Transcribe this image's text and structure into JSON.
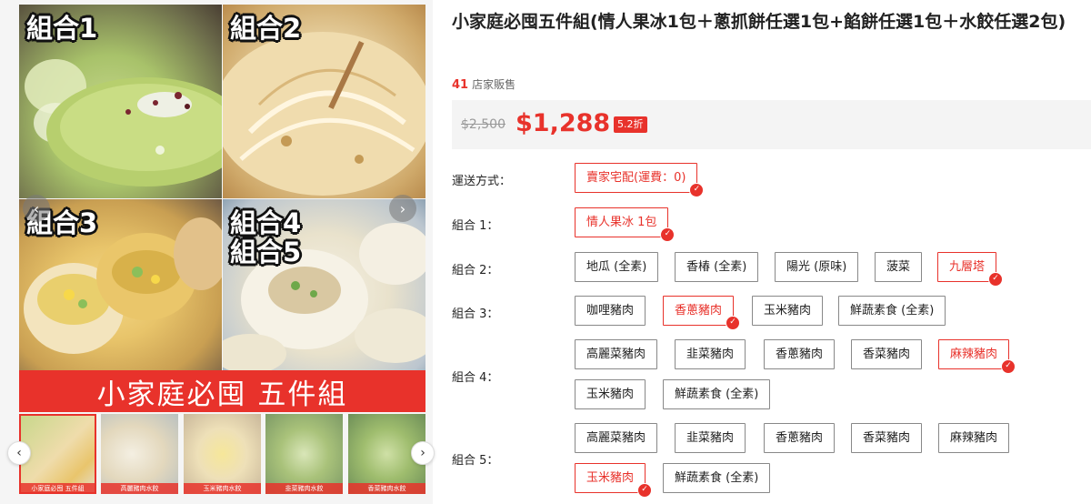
{
  "gallery": {
    "combo_tags": [
      "組合1",
      "組合2",
      "組合3",
      "組合4",
      "組合5"
    ],
    "banner_text": "小家庭必囤 五件組",
    "prev_icon": "chevron-left-icon",
    "next_icon": "chevron-right-icon",
    "thumb_captions": [
      "小家庭必囤 五件組",
      "高麗豬肉水餃",
      "玉米豬肉水餃",
      "韭菜豬肉水餃",
      "香菜豬肉水餃"
    ]
  },
  "product": {
    "title": "小家庭必囤五件組(情人果冰1包＋蔥抓餅任選1包+餡餅任選1包＋水餃任選2包)",
    "sales_count": "41",
    "sales_label": "店家販售",
    "original_price": "$2,500",
    "price": "$1,288",
    "discount": "5.2折"
  },
  "options": {
    "shipping": {
      "label": "運送方式：",
      "items": [
        "賣家宅配(運費：0)"
      ]
    },
    "combo1": {
      "label": "組合 1：",
      "items": [
        "情人果冰 1包"
      ]
    },
    "combo2": {
      "label": "組合 2：",
      "items": [
        "地瓜 (全素)",
        "香椿 (全素)",
        "陽光 (原味)",
        "菠菜",
        "九層塔"
      ]
    },
    "combo3": {
      "label": "組合 3：",
      "items": [
        "咖哩豬肉",
        "香蔥豬肉",
        "玉米豬肉",
        "鮮蔬素食 (全素)"
      ]
    },
    "combo4": {
      "label": "組合 4：",
      "items": [
        "高麗菜豬肉",
        "韭菜豬肉",
        "香蔥豬肉",
        "香菜豬肉",
        "麻辣豬肉",
        "玉米豬肉",
        "鮮蔬素食 (全素)"
      ]
    },
    "combo5": {
      "label": "組合 5：",
      "items": [
        "高麗菜豬肉",
        "韭菜豬肉",
        "香蔥豬肉",
        "香菜豬肉",
        "麻辣豬肉",
        "玉米豬肉",
        "鮮蔬素食 (全素)"
      ]
    }
  },
  "colors": {
    "accent": "#e8322b",
    "price_bg": "#f4f4f4"
  }
}
